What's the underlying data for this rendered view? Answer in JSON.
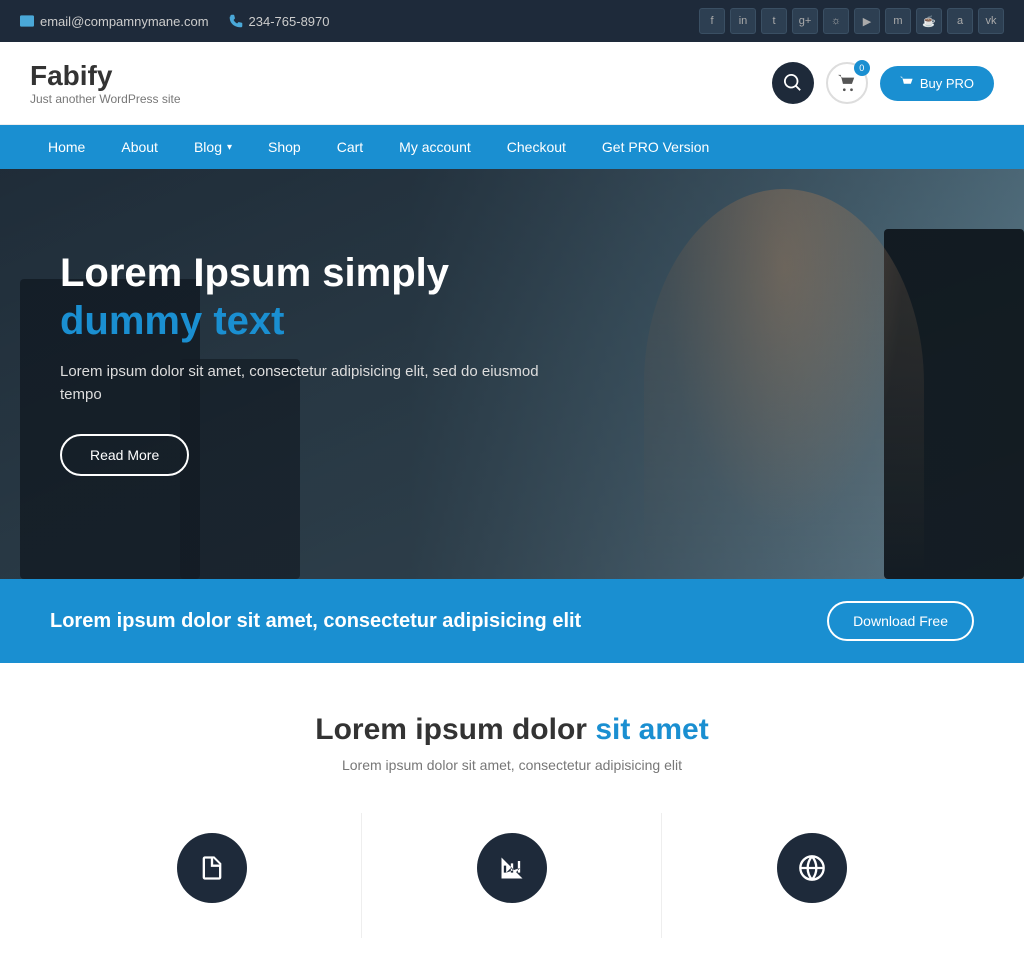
{
  "topbar": {
    "email": "email@compamnymane.com",
    "phone": "234-765-8970",
    "social_icons": [
      "f",
      "in",
      "t",
      "g+",
      "ig",
      "yt",
      "m",
      "sh",
      "a",
      "vk"
    ]
  },
  "header": {
    "logo_name": "Fabify",
    "logo_tagline": "Just another WordPress site",
    "cart_count": "0",
    "buy_pro_label": "Buy PRO"
  },
  "nav": {
    "items": [
      {
        "label": "Home",
        "has_dropdown": false
      },
      {
        "label": "About",
        "has_dropdown": false
      },
      {
        "label": "Blog",
        "has_dropdown": true
      },
      {
        "label": "Shop",
        "has_dropdown": false
      },
      {
        "label": "Cart",
        "has_dropdown": false
      },
      {
        "label": "My account",
        "has_dropdown": false
      },
      {
        "label": "Checkout",
        "has_dropdown": false
      },
      {
        "label": "Get PRO Version",
        "has_dropdown": false
      }
    ]
  },
  "hero": {
    "title_part1": "Lorem Ipsum simply",
    "title_highlight": "dummy text",
    "subtitle": "Lorem ipsum dolor sit amet, consectetur adipisicing elit, sed do eiusmod tempo",
    "cta_label": "Read More"
  },
  "cta_bar": {
    "text": "Lorem ipsum dolor sit amet, consectetur adipisicing elit",
    "button_label": "Download Free"
  },
  "features": {
    "title_part1": "Lorem ipsum dolor",
    "title_highlight": "sit amet",
    "subtitle": "Lorem ipsum dolor sit amet, consectetur adipisicing elit",
    "cards": [
      {
        "icon": "doc"
      },
      {
        "icon": "chart"
      },
      {
        "icon": "globe"
      }
    ]
  }
}
